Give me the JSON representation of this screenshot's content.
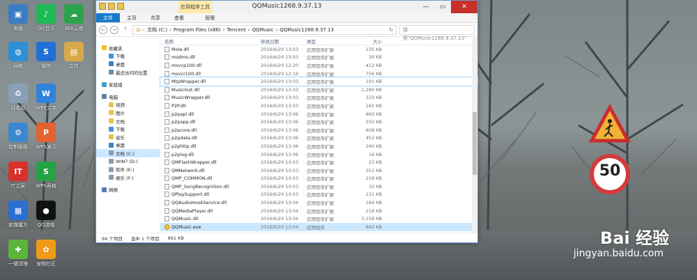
{
  "window": {
    "title": "QQMusic1268.9.37.13",
    "context_tab": "应用程序工具",
    "context_sub_tab": "管理",
    "ribbon_tabs": [
      "文件",
      "主页",
      "共享",
      "查看"
    ]
  },
  "address": {
    "path": [
      "文档 (C:)",
      "Program Files (x86)",
      "Tencent",
      "QQMusic",
      "QQMusic1268.9.37.13"
    ],
    "search_placeholder": "搜索\"QQMusic1268.9.37.13\""
  },
  "nav_pane": [
    {
      "label": "收藏夹",
      "group": true,
      "icon": "star-icon",
      "color": "#f2c12e"
    },
    {
      "label": "下载",
      "icon": "download-folder-icon",
      "color": "#4a90d9"
    },
    {
      "label": "桌面",
      "icon": "desktop-icon",
      "color": "#3b7fc4"
    },
    {
      "label": "最近访问的位置",
      "icon": "recent-icon",
      "color": "#6f8ba8"
    },
    {
      "label": "家庭组",
      "group": true,
      "icon": "homegroup-icon",
      "color": "#3ea0d0"
    },
    {
      "label": "电脑",
      "group": true,
      "icon": "computer-icon",
      "color": "#5d7fa3"
    },
    {
      "label": "视频",
      "icon": "video-folder-icon",
      "color": "#e8c14f"
    },
    {
      "label": "图片",
      "icon": "picture-folder-icon",
      "color": "#e8c14f"
    },
    {
      "label": "文档",
      "icon": "document-folder-icon",
      "color": "#e8c14f"
    },
    {
      "label": "下载",
      "icon": "download-folder-icon",
      "color": "#4a90d9"
    },
    {
      "label": "音乐",
      "icon": "music-folder-icon",
      "color": "#e8c14f"
    },
    {
      "label": "桌面",
      "icon": "desktop-icon",
      "color": "#3b7fc4"
    },
    {
      "label": "文档 (C:)",
      "icon": "drive-icon",
      "color": "#8a9bb0",
      "selected": true
    },
    {
      "label": "WIN7 (D:)",
      "icon": "drive-icon",
      "color": "#8a9bb0"
    },
    {
      "label": "软件 (E:)",
      "icon": "drive-icon",
      "color": "#8a9bb0"
    },
    {
      "label": "娱乐 (F:)",
      "icon": "drive-icon",
      "color": "#8a9bb0"
    },
    {
      "label": "网络",
      "group": true,
      "icon": "network-icon",
      "color": "#4f7fb5"
    }
  ],
  "columns": [
    "名称",
    "修改日期",
    "类型",
    "大小"
  ],
  "files": [
    {
      "name": "Mole.dll",
      "date": "2016/6/20 13:03",
      "type": "应用程序扩展",
      "size": "135 KB"
    },
    {
      "name": "msdmo.dll",
      "date": "2016/6/20 13:03",
      "type": "应用程序扩展",
      "size": "30 KB"
    },
    {
      "name": "msvcp100.dll",
      "date": "2016/6/20 12:20",
      "type": "应用程序扩展",
      "size": "412 KB"
    },
    {
      "name": "msvcr100.dll",
      "date": "2016/6/20 12:19",
      "type": "应用程序扩展",
      "size": "756 KB"
    },
    {
      "name": "MtpWrapper.dll",
      "date": "2016/6/20 13:03",
      "type": "应用程序扩展",
      "size": "191 KB",
      "hover": true
    },
    {
      "name": "MusicInst.dll",
      "date": "2016/6/20 13:03",
      "type": "应用程序扩展",
      "size": "1,280 KB"
    },
    {
      "name": "MusicWrapper.dll",
      "date": "2016/6/20 13:03",
      "type": "应用程序扩展",
      "size": "310 KB"
    },
    {
      "name": "P2P.dll",
      "date": "2016/6/20 13:03",
      "type": "应用程序扩展",
      "size": "165 KB"
    },
    {
      "name": "p2papi.dll",
      "date": "2016/6/20 13:06",
      "type": "应用程序扩展",
      "size": "660 KB"
    },
    {
      "name": "p2papp.dll",
      "date": "2016/6/20 13:06",
      "type": "应用程序扩展",
      "size": "332 KB"
    },
    {
      "name": "p2pcore.dll",
      "date": "2016/6/20 13:06",
      "type": "应用程序扩展",
      "size": "608 KB"
    },
    {
      "name": "p2pdata.dll",
      "date": "2016/6/20 13:06",
      "type": "应用程序扩展",
      "size": "452 KB"
    },
    {
      "name": "p2phttp.dll",
      "date": "2016/6/20 13:06",
      "type": "应用程序扩展",
      "size": "260 KB"
    },
    {
      "name": "p2plog.dll",
      "date": "2016/6/20 13:06",
      "type": "应用程序扩展",
      "size": "16 KB"
    },
    {
      "name": "QMFlashWrapper.dll",
      "date": "2016/6/20 13:03",
      "type": "应用程序扩展",
      "size": "23 KB"
    },
    {
      "name": "QMNetwork.dll",
      "date": "2016/6/20 13:03",
      "type": "应用程序扩展",
      "size": "351 KB"
    },
    {
      "name": "QMP_COMMON.dll",
      "date": "2016/6/20 13:03",
      "type": "应用程序扩展",
      "size": "218 KB"
    },
    {
      "name": "QMP_SongRecognition.dll",
      "date": "2016/6/20 13:03",
      "type": "应用程序扩展",
      "size": "33 KB"
    },
    {
      "name": "QPlaySupport.dll",
      "date": "2016/6/20 13:03",
      "type": "应用程序扩展",
      "size": "231 KB"
    },
    {
      "name": "QQAudioHookService.dll",
      "date": "2016/6/20 13:04",
      "type": "应用程序扩展",
      "size": "184 KB"
    },
    {
      "name": "QQMediaPlayer.dll",
      "date": "2016/6/20 13:04",
      "type": "应用程序扩展",
      "size": "218 KB"
    },
    {
      "name": "QQMusic.dll",
      "date": "2016/6/20 13:04",
      "type": "应用程序扩展",
      "size": "5,156 KB"
    },
    {
      "name": "QQMusic.exe",
      "date": "2016/6/20 13:04",
      "type": "应用程序",
      "size": "662 KB",
      "selected": true,
      "exe": true
    }
  ],
  "status": {
    "count": "94 个项目",
    "selected": "选中 1 个项目",
    "size": "661 KB"
  },
  "desktop_icons": [
    {
      "label": "电脑",
      "color": "#3a7cc5",
      "glyph": "▣"
    },
    {
      "label": "QQ音乐",
      "color": "#1db954",
      "glyph": "♪"
    },
    {
      "label": "360云盘",
      "color": "#2aa34a",
      "glyph": "☁"
    },
    {
      "label": "网络",
      "color": "#2d8fd5",
      "glyph": "◍"
    },
    {
      "label": "搜狗",
      "color": "#1f6fd6",
      "glyph": "S"
    },
    {
      "label": "文件",
      "color": "#d8a94a",
      "glyph": "▤"
    },
    {
      "label": "回收站",
      "color": "#8aa0b8",
      "glyph": "♻"
    },
    {
      "label": "WPS文字",
      "color": "#2f84d9",
      "glyph": "W"
    },
    {
      "label": "控制面板",
      "color": "#3b88cf",
      "glyph": "⚙"
    },
    {
      "label": "WPS演示",
      "color": "#e3622d",
      "glyph": "P"
    },
    {
      "label": "IT之家",
      "color": "#d8302a",
      "glyph": "IT"
    },
    {
      "label": "WPS表格",
      "color": "#22a345",
      "glyph": "S"
    },
    {
      "label": "软媒魔方",
      "color": "#2a6fd1",
      "glyph": "▦"
    },
    {
      "label": "QQ游戏",
      "color": "#111111",
      "glyph": "●"
    },
    {
      "label": "一键清理",
      "color": "#5bb53a",
      "glyph": "✚"
    },
    {
      "label": "宠物社区",
      "color": "#f09a1a",
      "glyph": "✿"
    }
  ],
  "road_sign": {
    "speed": "50"
  },
  "watermark": {
    "brand": "Bai 经验",
    "url": "jingyan.baidu.com"
  }
}
